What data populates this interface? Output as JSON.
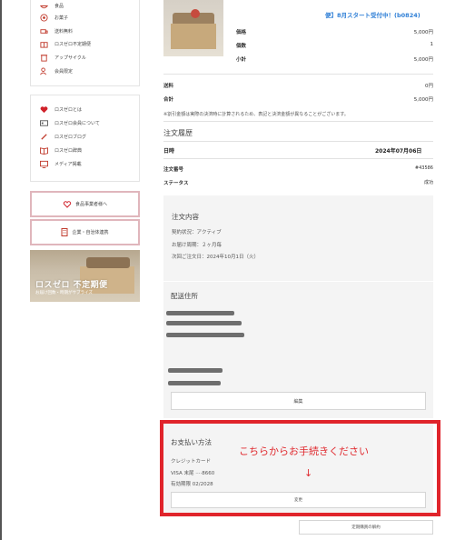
{
  "sidebar": {
    "group1": [
      {
        "label": "食品",
        "icon": "bowl-icon"
      },
      {
        "label": "お菓子",
        "icon": "sweets-icon"
      },
      {
        "label": "送料無料",
        "icon": "truck-icon"
      },
      {
        "label": "ロスゼロ不定期便",
        "icon": "gift-box-icon"
      },
      {
        "label": "アップサイクル",
        "icon": "recycle-icon"
      },
      {
        "label": "会員限定",
        "icon": "member-icon"
      }
    ],
    "group2": [
      {
        "label": "ロスゼロとは",
        "icon": "heart-icon"
      },
      {
        "label": "ロスゼロ会員について",
        "icon": "card-icon"
      },
      {
        "label": "ロスゼロブログ",
        "icon": "pen-icon"
      },
      {
        "label": "ロスゼロ辞典",
        "icon": "book-icon"
      },
      {
        "label": "メディア掲載",
        "icon": "monitor-icon"
      }
    ],
    "btn_food": "食品事業者様へ",
    "btn_corp": "企業・自治体連携",
    "banner_title": "ロスゼロ 不定期便",
    "banner_sub": "お届け回数・時期がサプライズ"
  },
  "product": {
    "title_line": "便】8月スタート受付中！(b0824)",
    "price_label": "価格",
    "price_value": "5,000円",
    "qty_label": "個数",
    "qty_value": "1",
    "subtotal_label": "小計",
    "subtotal_value": "5,000円"
  },
  "totals": {
    "shipping_label": "送料",
    "shipping_value": "0円",
    "total_label": "合計",
    "total_value": "5,000円",
    "note": "※割引金額は実際の決済時に計算されるため、表記と決済金額が異なることがございます。"
  },
  "history": {
    "heading": "注文履歴",
    "date_label": "日時",
    "date_value": "2024年07月06日",
    "order_label": "注文番号",
    "order_value": "#43586",
    "status_label": "ステータス",
    "status_value": "成功"
  },
  "contents": {
    "title": "注文内容",
    "line1": "契約状況：アクティブ",
    "line2": "お届け周期：２ヶ月毎",
    "line3": "次回ご注文日：2024年10月1日（火）"
  },
  "shipping_addr": {
    "title": "配送住所",
    "edit_button": "編集"
  },
  "payment": {
    "title": "お支払い方法",
    "method": "クレジットカード",
    "card": "VISA 末尾 ····8660",
    "expiry": "有効期限 02/2028",
    "change_button": "変更"
  },
  "annotation": {
    "message": "こちらからお手続きください",
    "arrow": "↓"
  },
  "footer_button": "定期購買の解約",
  "colors": {
    "highlight_red": "#e0242b",
    "link_blue": "#2f7fd6",
    "sidebar_btn_border": "#e0b6bc"
  }
}
